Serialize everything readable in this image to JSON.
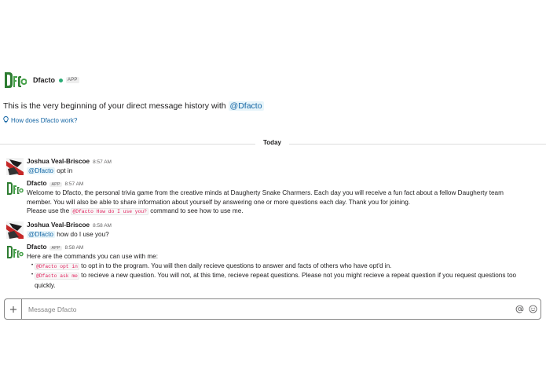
{
  "intro": {
    "bot_name": "Dfacto",
    "app_tag": "APP",
    "text": "This is the very beginning of your direct message history with ",
    "mention": "@Dfacto",
    "help_link": "How does Dfacto work?"
  },
  "day_divider": "Today",
  "messages": [
    {
      "author": "Joshua Veal-Briscoe",
      "time": "8:57 AM",
      "mention": "@Dfacto",
      "text": " opt in"
    },
    {
      "author": "Dfacto",
      "app_tag": "APP",
      "time": "8:57 AM",
      "line1": "Welcome to Dfacto, the personal trivia game from the creative minds at Daugherty Snake Charmers.  Each day you will receive a fun fact about a fellow Daugherty team",
      "line2": "member.  You will also be able to share information about yourself by answering one or more questions each day. Thank you for joining.",
      "line3_pre": "Please use the ",
      "line3_code": "@Dfacto How do I use you?",
      "line3_post": " command to see how to use me."
    },
    {
      "author": "Joshua Veal-Briscoe",
      "time": "8:58 AM",
      "mention": "@Dfacto",
      "text": " how do I use you?"
    },
    {
      "author": "Dfacto",
      "app_tag": "APP",
      "time": "8:58 AM",
      "intro": "Here are the commands you can use with me:",
      "bullets": [
        {
          "code": "@Dfacto opt in",
          "text": " to opt in to the program. You will then daily recieve questions to answer and facts of others who have opt'd in."
        },
        {
          "code": "@Dfacto ask me",
          "text": " to recieve a new question. You will not, at this time, recieve repeat questions. Please not you might recieve a repeat question if you request questions too quickly."
        }
      ]
    }
  ],
  "composer": {
    "placeholder": "Message Dfacto",
    "plus_icon": "plus-icon",
    "at_icon": "at-icon",
    "emoji_icon": "emoji-icon"
  },
  "colors": {
    "presence": "#2bac76",
    "link": "#1264a3",
    "code": "#e01e5a",
    "bot_logo": "#2e7d32"
  }
}
